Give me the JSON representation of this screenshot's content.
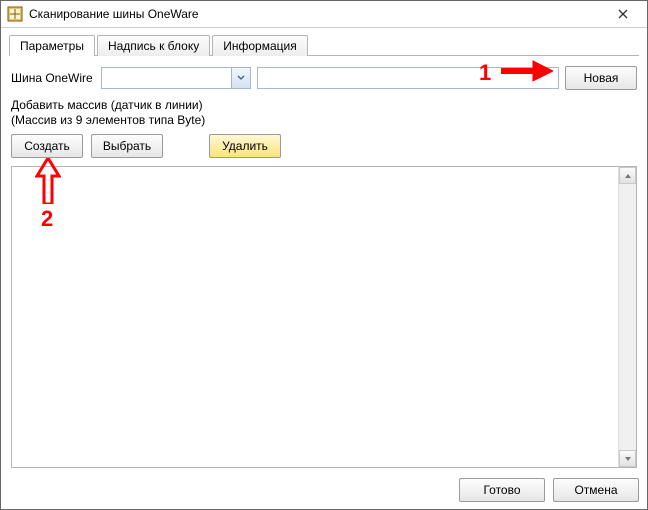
{
  "window": {
    "title": "Сканирование шины OneWare"
  },
  "tabs": {
    "params": "Параметры",
    "caption": "Надпись к блоку",
    "info": "Информация"
  },
  "form": {
    "bus_label": "Шина OneWire",
    "combo_value": "",
    "text_value": "",
    "new_btn": "Новая",
    "add_array_line1": "Добавить массив (датчик в линии)",
    "add_array_line2": "(Массив из 9 элементов типа Byte)",
    "create_btn": "Создать",
    "select_btn": "Выбрать",
    "delete_btn": "Удалить"
  },
  "footer": {
    "ok": "Готово",
    "cancel": "Отмена"
  },
  "annotations": {
    "one": "1",
    "two": "2"
  }
}
